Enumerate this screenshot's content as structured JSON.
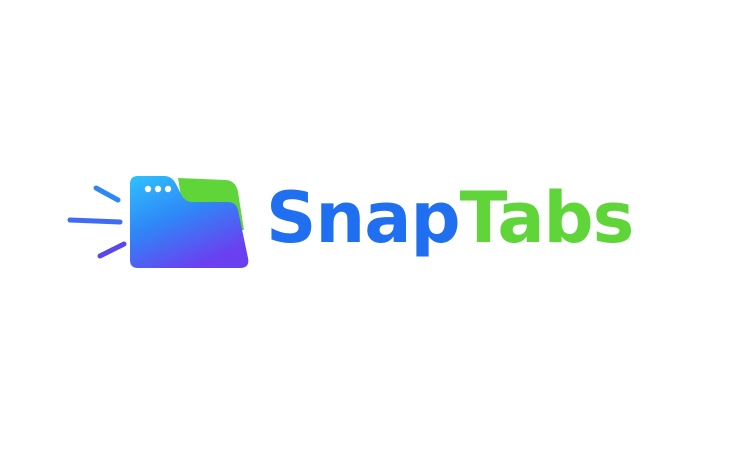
{
  "logo": {
    "name_part_1": "Snap",
    "name_part_2": "Tabs",
    "icon": "folder-with-speed-lines-icon"
  },
  "colors": {
    "blue": "#1f6ff0",
    "green": "#5fd53a",
    "purple": "#6a3ff0",
    "background": "#ffffff"
  }
}
